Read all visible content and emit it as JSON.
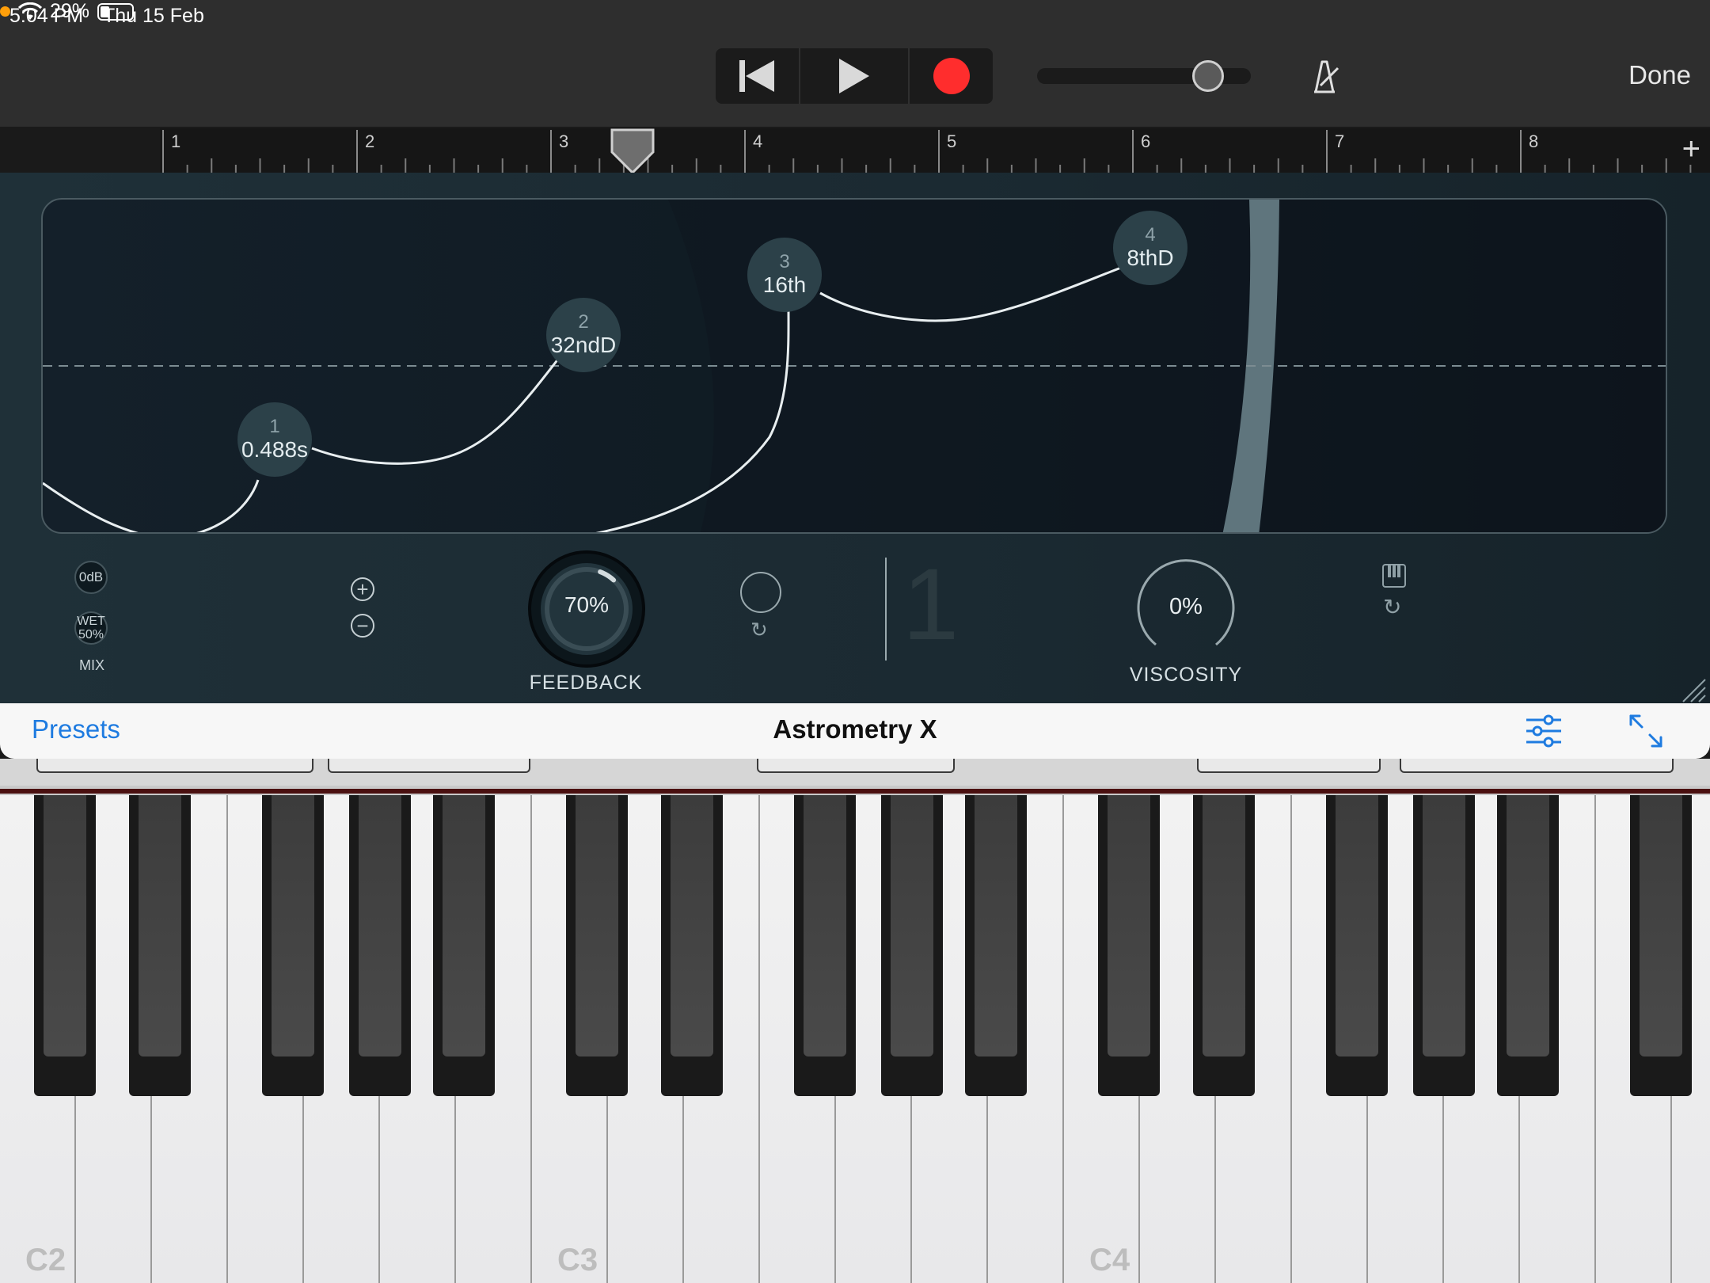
{
  "status": {
    "time": "5:04 PM",
    "date": "Thu 15 Feb",
    "battery": "29%",
    "battery_level": 0.29
  },
  "transport": {
    "done_label": "Done",
    "volume_level": 0.85
  },
  "ruler": {
    "bars": [
      "1",
      "2",
      "3",
      "4",
      "5",
      "6",
      "7",
      "8"
    ],
    "playhead_bar": 3.42,
    "add_label": "+"
  },
  "graph": {
    "nodes": [
      {
        "index": "1",
        "value": "0.488s"
      },
      {
        "index": "2",
        "value": "32ndD"
      },
      {
        "index": "3",
        "value": "16th"
      },
      {
        "index": "4",
        "value": "8thD"
      }
    ]
  },
  "controls": {
    "level": "0dB",
    "wet_label": "WET",
    "wet_value": "50%",
    "mix_label": "MIX",
    "plus": "+",
    "minus": "−",
    "feedback_value": "70%",
    "feedback_label": "FEEDBACK",
    "feedback_level": 0.7,
    "big_number": "1",
    "viscosity_value": "0%",
    "viscosity_label": "VISCOSITY"
  },
  "presets_bar": {
    "presets_label": "Presets",
    "title": "Astrometry X"
  },
  "keyboard": {
    "octave_labels": [
      "C2",
      "C3",
      "C4"
    ]
  },
  "colors": {
    "record": "#ff2d2d",
    "accent_blue": "#1e7be0",
    "orange_dot": "#ff9f0a"
  }
}
